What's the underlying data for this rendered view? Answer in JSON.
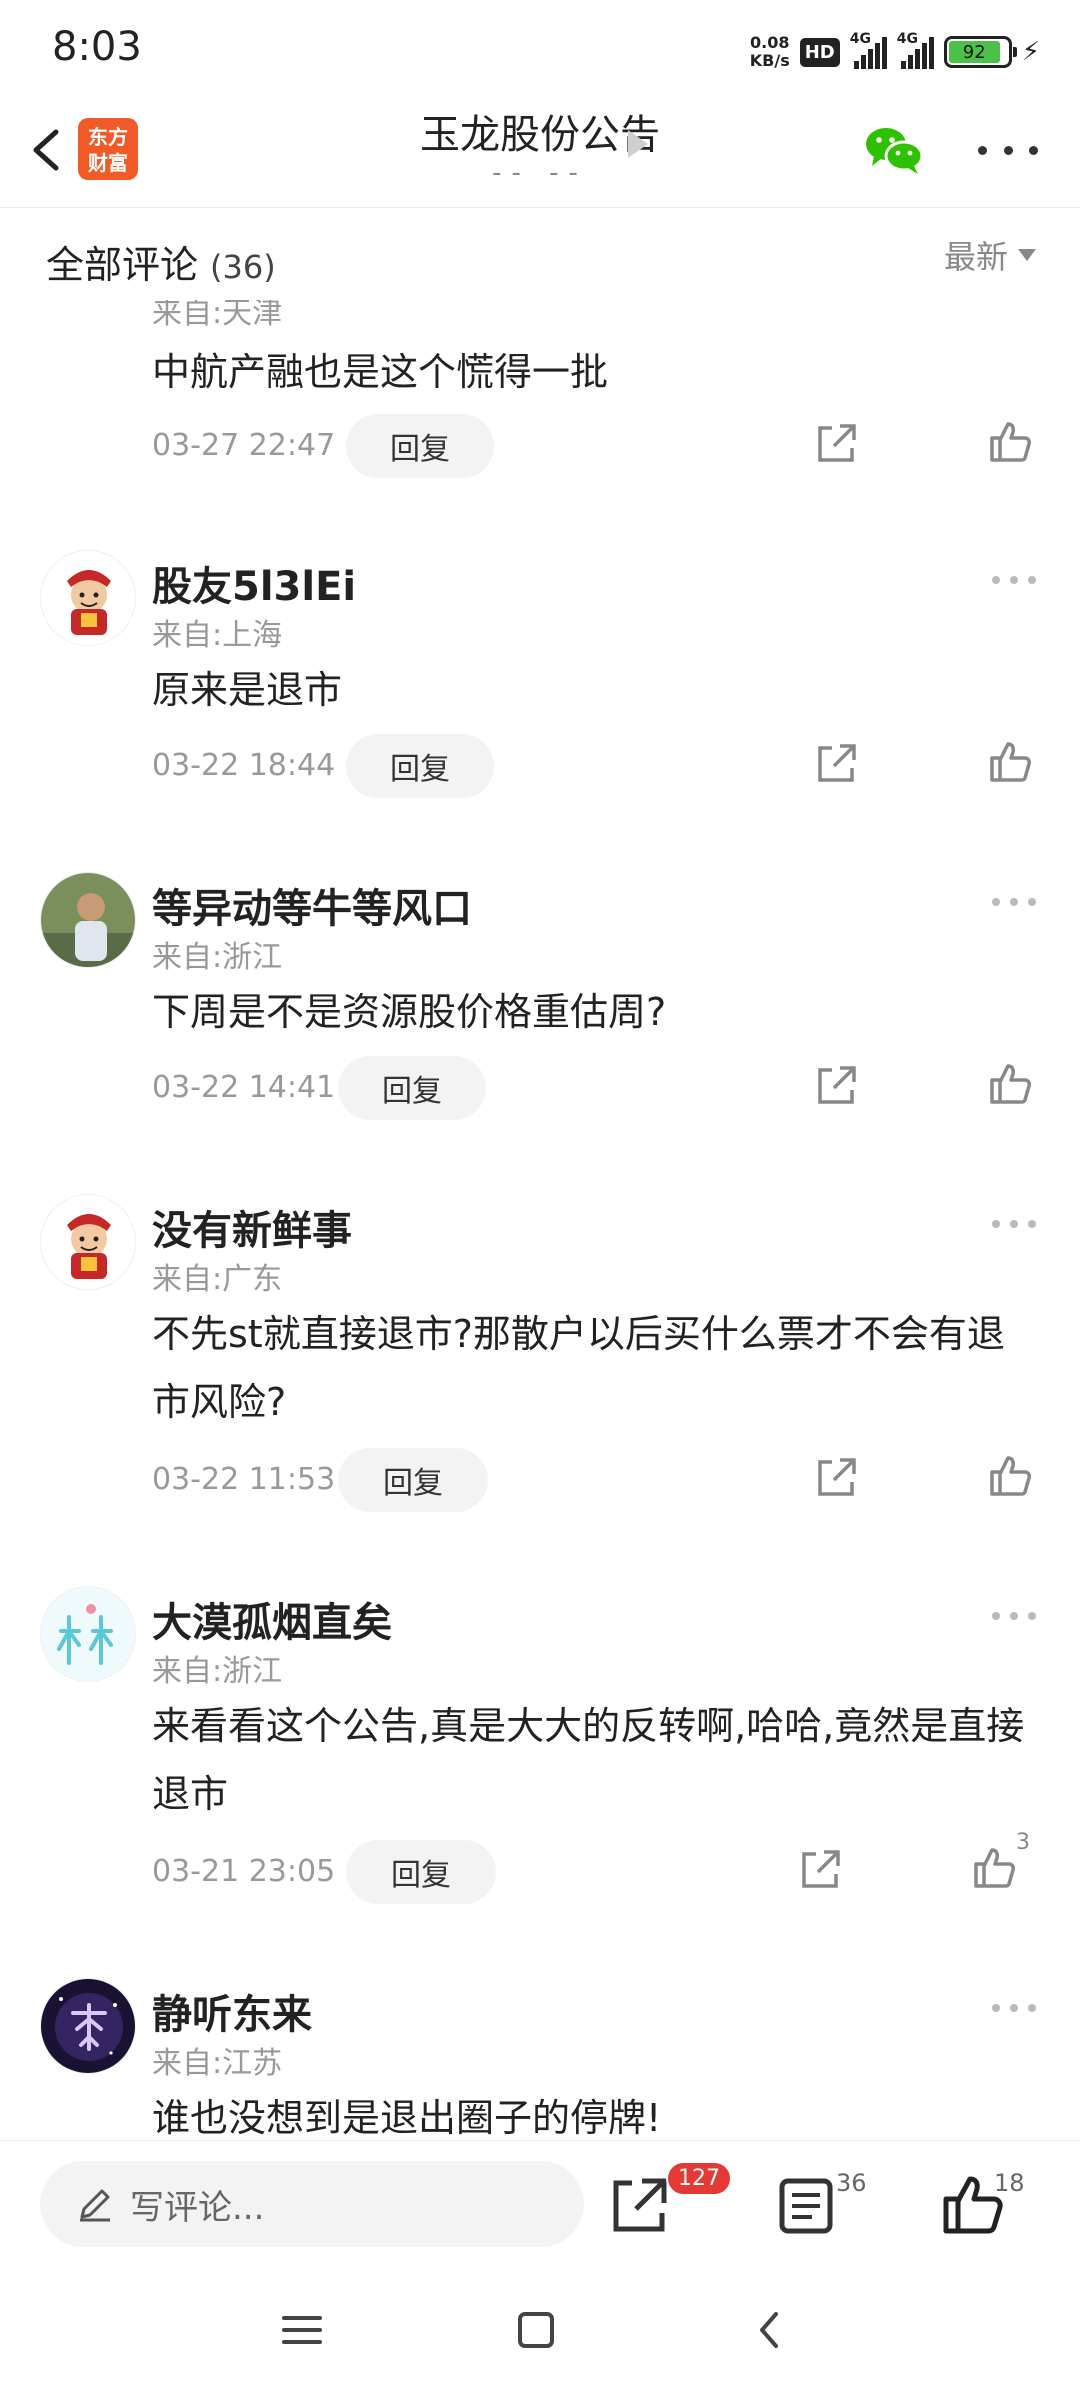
{
  "status_bar": {
    "time": "8:03",
    "net_speed_value": "0.08",
    "net_speed_unit": "KB/s",
    "hd_label": "HD",
    "signal1_label": "4G",
    "signal2_label": "4G",
    "battery": "92"
  },
  "header": {
    "logo_line1": "东方",
    "logo_line2": "财富",
    "title": "玉龙股份公告",
    "subtitle": "-- --"
  },
  "comments_header": {
    "label": "全部评论",
    "count": "(36)",
    "sort": "最新"
  },
  "comments": [
    {
      "name": "",
      "from": "来自:天津",
      "text": "中航产融也是这个慌得一批",
      "time": "03-27 22:47",
      "reply": "回复",
      "likes": ""
    },
    {
      "name": "股友5l3lEi",
      "from": "来自:上海",
      "text": "原来是退市",
      "time": "03-22 18:44",
      "reply": "回复",
      "likes": ""
    },
    {
      "name": "等异动等牛等风口",
      "from": "来自:浙江",
      "text": "下周是不是资源股价格重估周?",
      "time": "03-22 14:41",
      "reply": "回复",
      "likes": ""
    },
    {
      "name": "没有新鲜事",
      "from": "来自:广东",
      "text": "不先st就直接退市?那散户以后买什么票才不会有退市风险?",
      "time": "03-22 11:53",
      "reply": "回复",
      "likes": ""
    },
    {
      "name": "大漠孤烟直矣",
      "from": "来自:浙江",
      "text": "来看看这个公告,真是大大的反转啊,哈哈,竟然是直接退市",
      "time": "03-21 23:05",
      "reply": "回复",
      "likes": "3"
    },
    {
      "name": "静听东来",
      "from": "来自:江苏",
      "text": "谁也没想到是退出圈子的停牌!",
      "time": "",
      "reply": "",
      "likes": ""
    }
  ],
  "bottom_bar": {
    "write_placeholder": "写评论...",
    "share_badge": "127",
    "comments_count": "36",
    "likes_count": "18"
  },
  "colors": {
    "brand_orange": "#f05a28",
    "wechat_green": "#2dc100",
    "badge_red": "#e53935"
  }
}
